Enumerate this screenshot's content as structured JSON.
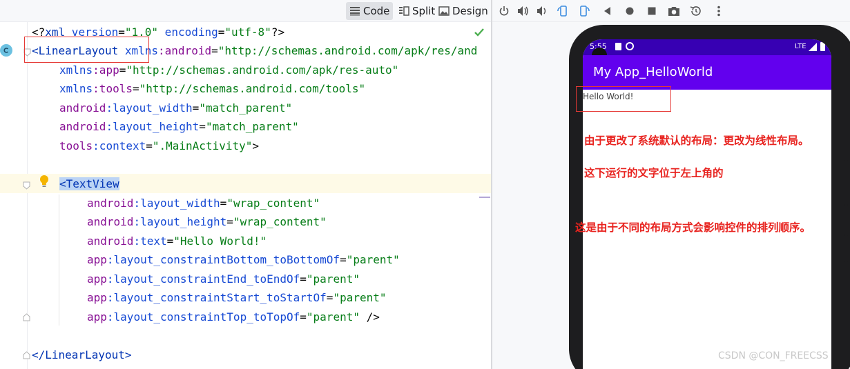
{
  "toolbar": {
    "modes": [
      {
        "label": "Code",
        "icon": "lines-icon",
        "active": true
      },
      {
        "label": "Split",
        "icon": "split-icon",
        "active": false
      },
      {
        "label": "Design",
        "icon": "image-icon",
        "active": false
      }
    ]
  },
  "editor": {
    "lines": [
      {
        "l1_a": "<?",
        "l1_b": "xml version",
        "l1_c": "=",
        "l1_d": "\"1.0\"",
        "l1_e": " encoding",
        "l1_f": "=",
        "l1_g": "\"utf-8\"",
        "l1_h": "?>"
      }
    ],
    "xml_decl": {
      "open": "<?",
      "xml": "xml",
      "version_attr": " version",
      "version_val": "\"1.0\"",
      "encoding_attr": " encoding",
      "encoding_val": "\"utf-8\"",
      "close": "?>"
    },
    "linear_open": {
      "tag": "<LinearLayout",
      "ns1": " xmlns",
      "ns1_colon": ":android",
      "ns1_val": "\"http://schemas.android.com/apk/res/and"
    },
    "xmlns_app": {
      "attr": "xmlns",
      "name": ":app",
      "val": "\"http://schemas.android.com/apk/res-auto\""
    },
    "xmlns_tools": {
      "attr": "xmlns",
      "name": ":tools",
      "val": "\"http://schemas.android.com/tools\""
    },
    "lin_width": {
      "ns": "android",
      "name": ":layout_width",
      "val": "\"match_parent\""
    },
    "lin_height": {
      "ns": "android",
      "name": ":layout_height",
      "val": "\"match_parent\""
    },
    "lin_context": {
      "ns": "tools",
      "name": ":context",
      "val": "\".MainActivity\"",
      "end": ">"
    },
    "textview_tag": "<TextView",
    "tv_attrs": [
      {
        "ns": "android",
        "name": ":layout_width",
        "val": "\"wrap_content\"",
        "end": ""
      },
      {
        "ns": "android",
        "name": ":layout_height",
        "val": "\"wrap_content\"",
        "end": ""
      },
      {
        "ns": "android",
        "name": ":text",
        "val": "\"Hello World!\"",
        "end": ""
      },
      {
        "ns": "app",
        "name": ":layout_constraintBottom_toBottomOf",
        "val": "\"parent\"",
        "end": ""
      },
      {
        "ns": "app",
        "name": ":layout_constraintEnd_toEndOf",
        "val": "\"parent\"",
        "end": ""
      },
      {
        "ns": "app",
        "name": ":layout_constraintStart_toStartOf",
        "val": "\"parent\"",
        "end": ""
      },
      {
        "ns": "app",
        "name": ":layout_constraintTop_toTopOf",
        "val": "\"parent\"",
        "end": " />"
      }
    ],
    "linear_close": "</LinearLayout>",
    "eq": "="
  },
  "emulator": {
    "status_time": "5:55",
    "network": "LTE",
    "app_title": "My App_HelloWorld",
    "hello_text": "Hello World!"
  },
  "notes": {
    "line1": "由于更改了系统默认的布局：更改为线性布局。",
    "line2": "这下运行的文字位于左上角的",
    "line3": "这是由于不同的布局方式会影响控件的排列顺序。"
  },
  "watermark": "CSDN @CON_FREECSS",
  "colors": {
    "accent_red": "#e53935",
    "app_bar": "#6200ee",
    "status_bar": "#3700b3"
  }
}
